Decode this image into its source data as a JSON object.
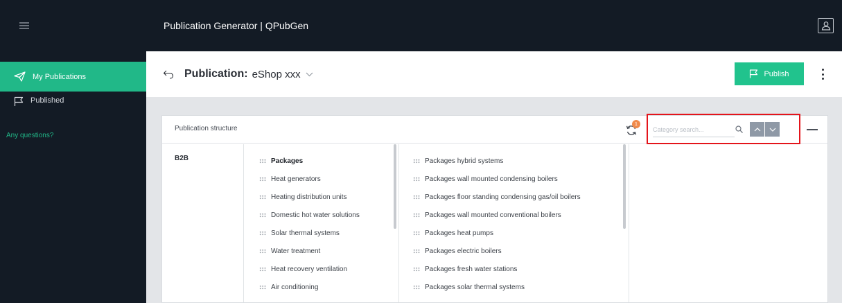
{
  "app": {
    "title": "Publication Generator | QPubGen"
  },
  "sidebar": {
    "items": [
      {
        "label": "My Publications",
        "icon": "send-icon",
        "active": true
      },
      {
        "label": "Published",
        "icon": "flag-icon",
        "active": false
      }
    ],
    "questions_link": "Any questions?"
  },
  "header": {
    "publication_label": "Publication:",
    "publication_name": "eShop xxx",
    "publish_label": "Publish"
  },
  "panel": {
    "title": "Publication structure",
    "sync_badge": "1",
    "search_placeholder": "Category search...",
    "root": "B2B",
    "column1": [
      {
        "label": "Packages",
        "selected": true
      },
      {
        "label": "Heat generators"
      },
      {
        "label": "Heating distribution units"
      },
      {
        "label": "Domestic hot water solutions"
      },
      {
        "label": "Solar thermal systems"
      },
      {
        "label": "Water treatment"
      },
      {
        "label": "Heat recovery ventilation"
      },
      {
        "label": "Air conditioning"
      }
    ],
    "column2": [
      {
        "label": "Packages hybrid systems"
      },
      {
        "label": "Packages wall mounted condensing boilers"
      },
      {
        "label": "Packages floor standing condensing gas/oil boilers"
      },
      {
        "label": "Packages wall mounted conventional boilers"
      },
      {
        "label": "Packages heat pumps"
      },
      {
        "label": "Packages electric boilers"
      },
      {
        "label": "Packages fresh water stations"
      },
      {
        "label": "Packages solar thermal systems"
      }
    ]
  },
  "colors": {
    "accent": "#21b888",
    "dark": "#131b25",
    "highlight": "#e4141b",
    "badge": "#f08a4b"
  }
}
